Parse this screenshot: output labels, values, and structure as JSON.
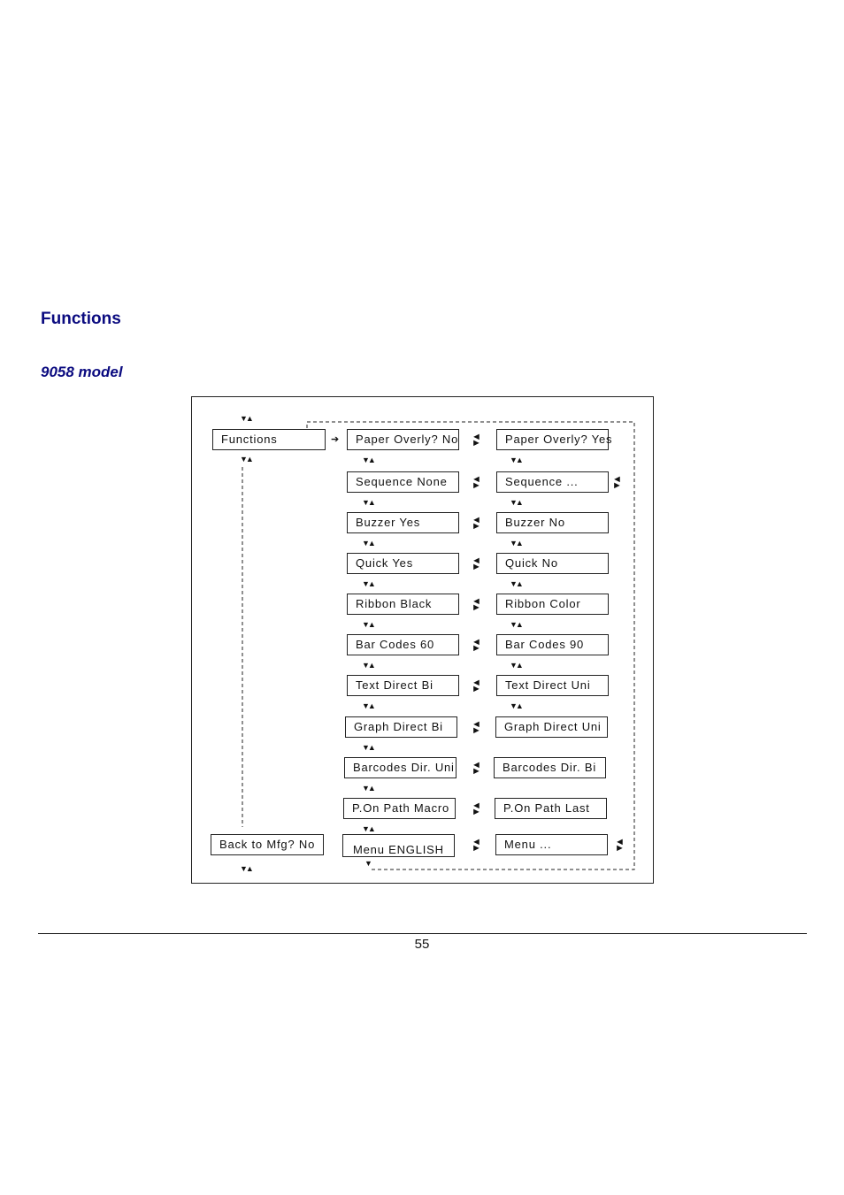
{
  "heading": "Functions",
  "subheading": "9058 model",
  "diagram": {
    "root": "Functions",
    "back": "Back to Mfg? No",
    "left_column": [
      "Paper Overly? No",
      "Sequence None",
      "Buzzer Yes",
      "Quick Yes",
      "Ribbon Black",
      "Bar Codes 60",
      "Text Direct Bi",
      "Graph Direct Bi",
      "Barcodes Dir. Uni",
      "P.On Path Macro",
      "Menu ENGLISH"
    ],
    "right_column": [
      "Paper Overly? Yes",
      "Sequence ...",
      "Buzzer No",
      "Quick No",
      "Ribbon Color",
      "Bar Codes 90",
      "Text Direct Uni",
      "Graph Direct Uni",
      "Barcodes Dir. Bi",
      "P.On Path Last",
      "Menu ..."
    ],
    "icons": {
      "updown": "up-down-arrows-icon",
      "swap": "left-right-swap-icon",
      "right": "right-arrow-icon",
      "down": "down-arrow-icon"
    }
  },
  "footer": {
    "page_number": "55"
  }
}
